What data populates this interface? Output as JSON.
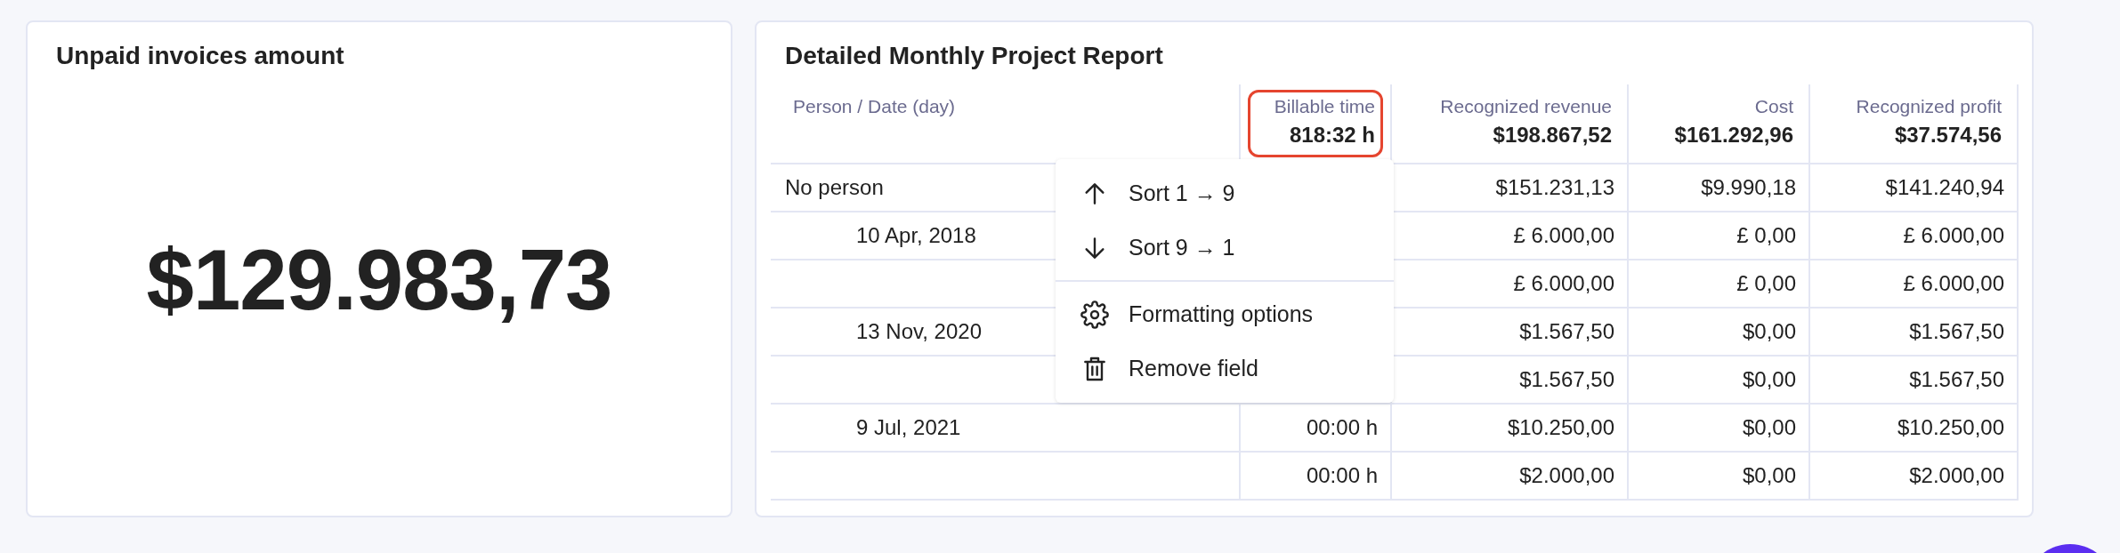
{
  "unpaid_card": {
    "title": "Unpaid invoices amount",
    "amount": "$129.983,73"
  },
  "report_card": {
    "title": "Detailed Monthly Project Report",
    "columns": [
      {
        "label": "Person / Date (day)",
        "selected": false
      },
      {
        "label": "Billable time",
        "total": "818:32 h",
        "selected": true
      },
      {
        "label": "Recognized revenue",
        "total": "$198.867,52",
        "selected": false
      },
      {
        "label": "Cost",
        "total": "$161.292,96",
        "selected": false
      },
      {
        "label": "Recognized profit",
        "total": "$37.574,56",
        "selected": false
      }
    ],
    "rows": [
      {
        "cells": [
          "No person",
          "",
          "$151.231,13",
          "$9.990,18",
          "$141.240,94"
        ],
        "children": [
          {
            "cells": [
              "10 Apr, 2018",
              "",
              "£ 6.000,00",
              "£ 0,00",
              "£ 6.000,00"
            ],
            "children": [
              {
                "cells": [
                  "",
                  "",
                  "£ 6.000,00",
                  "£ 0,00",
                  "£ 6.000,00"
                ]
              }
            ]
          },
          {
            "cells": [
              "13 Nov, 2020",
              "",
              "$1.567,50",
              "$0,00",
              "$1.567,50"
            ],
            "children": [
              {
                "cells": [
                  "",
                  "",
                  "$1.567,50",
                  "$0,00",
                  "$1.567,50"
                ]
              }
            ]
          },
          {
            "cells": [
              "9 Jul, 2021",
              "00:00 h",
              "$10.250,00",
              "$0,00",
              "$10.250,00"
            ],
            "children": [
              {
                "cells": [
                  "",
                  "00:00 h",
                  "$2.000,00",
                  "$0,00",
                  "$2.000,00"
                ]
              }
            ]
          }
        ]
      }
    ],
    "menu": {
      "groups": [
        [
          {
            "label": "Sort 1 → 9",
            "kind": "sort-ascending"
          },
          {
            "label": "Sort 9 → 1",
            "kind": "sort-descending"
          }
        ],
        [
          {
            "label": "Formatting options",
            "kind": "settings"
          },
          {
            "label": "Remove field",
            "kind": "delete"
          }
        ]
      ]
    }
  }
}
